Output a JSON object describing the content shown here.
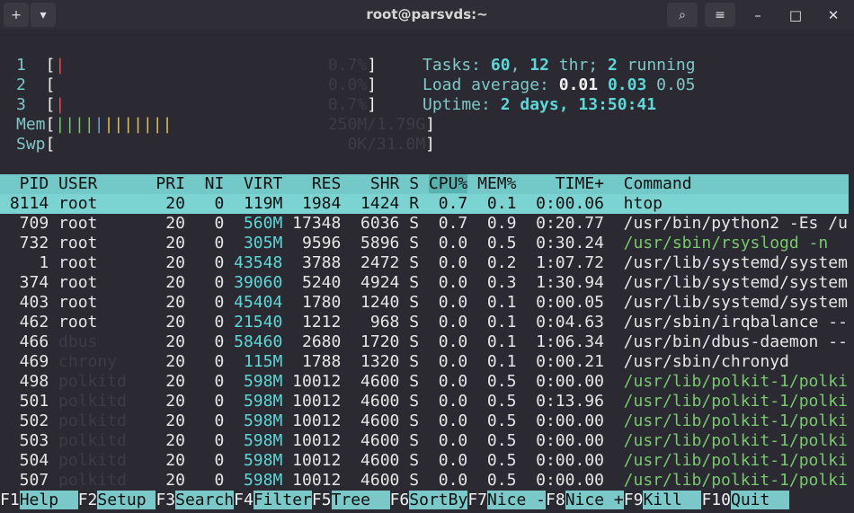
{
  "window": {
    "title": "root@parsvds:~",
    "buttons": {
      "new_tab": "+",
      "menu_dropdown": "▾",
      "search": "⌕",
      "hamburger": "≡",
      "minimize": "–",
      "maximize": "□",
      "close": "✕"
    }
  },
  "meters": {
    "cpu1": {
      "label": "1",
      "value": "0.7%"
    },
    "cpu2": {
      "label": "2",
      "value": "0.0%"
    },
    "cpu3": {
      "label": "3",
      "value": "0.7%"
    },
    "mem": {
      "label": "Mem",
      "value": "250M/1.79G"
    },
    "swp": {
      "label": "Swp",
      "value": "0K/31.0M"
    }
  },
  "summary": {
    "tasks_label": "Tasks:",
    "tasks": "60",
    "threads": "12",
    "thr_label": "thr;",
    "running": "2",
    "running_label": "running",
    "load_label": "Load average:",
    "load1": "0.01",
    "load5": "0.03",
    "load15": "0.05",
    "uptime_label": "Uptime:",
    "uptime": "2 days, 13:50:41"
  },
  "columns": [
    "PID",
    "USER",
    "PRI",
    "NI",
    "VIRT",
    "RES",
    "SHR",
    "S",
    "CPU%",
    "MEM%",
    "TIME+",
    "Command"
  ],
  "processes": [
    {
      "pid": "8114",
      "user": "root",
      "pri": "20",
      "ni": "0",
      "virt": "119M",
      "res": "1984",
      "shr": "1424",
      "s": "R",
      "cpu": "0.7",
      "mem": "0.1",
      "time": "0:00.06",
      "cmd": "htop"
    },
    {
      "pid": "709",
      "user": "root",
      "pri": "20",
      "ni": "0",
      "virt": "560M",
      "res": "17348",
      "shr": "6036",
      "s": "S",
      "cpu": "0.7",
      "mem": "0.9",
      "time": "0:20.77",
      "cmd": "/usr/bin/python2 -Es /u"
    },
    {
      "pid": "732",
      "user": "root",
      "pri": "20",
      "ni": "0",
      "virt": "305M",
      "res": "9596",
      "shr": "5896",
      "s": "S",
      "cpu": "0.0",
      "mem": "0.5",
      "time": "0:30.24",
      "cmd": "/usr/sbin/rsyslogd -n"
    },
    {
      "pid": "1",
      "user": "root",
      "pri": "20",
      "ni": "0",
      "virt": "43548",
      "res": "3788",
      "shr": "2472",
      "s": "S",
      "cpu": "0.0",
      "mem": "0.2",
      "time": "1:07.72",
      "cmd": "/usr/lib/systemd/system"
    },
    {
      "pid": "374",
      "user": "root",
      "pri": "20",
      "ni": "0",
      "virt": "39060",
      "res": "5240",
      "shr": "4924",
      "s": "S",
      "cpu": "0.0",
      "mem": "0.3",
      "time": "1:30.94",
      "cmd": "/usr/lib/systemd/system"
    },
    {
      "pid": "403",
      "user": "root",
      "pri": "20",
      "ni": "0",
      "virt": "45404",
      "res": "1780",
      "shr": "1240",
      "s": "S",
      "cpu": "0.0",
      "mem": "0.1",
      "time": "0:00.05",
      "cmd": "/usr/lib/systemd/system"
    },
    {
      "pid": "462",
      "user": "root",
      "pri": "20",
      "ni": "0",
      "virt": "21540",
      "res": "1212",
      "shr": "968",
      "s": "S",
      "cpu": "0.0",
      "mem": "0.1",
      "time": "0:04.63",
      "cmd": "/usr/sbin/irqbalance --"
    },
    {
      "pid": "466",
      "user": "dbus",
      "pri": "20",
      "ni": "0",
      "virt": "58460",
      "res": "2680",
      "shr": "1720",
      "s": "S",
      "cpu": "0.0",
      "mem": "0.1",
      "time": "1:06.34",
      "cmd": "/usr/bin/dbus-daemon --"
    },
    {
      "pid": "469",
      "user": "chrony",
      "pri": "20",
      "ni": "0",
      "virt": "115M",
      "res": "1788",
      "shr": "1320",
      "s": "S",
      "cpu": "0.0",
      "mem": "0.1",
      "time": "0:00.21",
      "cmd": "/usr/sbin/chronyd"
    },
    {
      "pid": "498",
      "user": "polkitd",
      "pri": "20",
      "ni": "0",
      "virt": "598M",
      "res": "10012",
      "shr": "4600",
      "s": "S",
      "cpu": "0.0",
      "mem": "0.5",
      "time": "0:00.00",
      "cmd": "/usr/lib/polkit-1/polki"
    },
    {
      "pid": "501",
      "user": "polkitd",
      "pri": "20",
      "ni": "0",
      "virt": "598M",
      "res": "10012",
      "shr": "4600",
      "s": "S",
      "cpu": "0.0",
      "mem": "0.5",
      "time": "0:13.96",
      "cmd": "/usr/lib/polkit-1/polki"
    },
    {
      "pid": "502",
      "user": "polkitd",
      "pri": "20",
      "ni": "0",
      "virt": "598M",
      "res": "10012",
      "shr": "4600",
      "s": "S",
      "cpu": "0.0",
      "mem": "0.5",
      "time": "0:00.00",
      "cmd": "/usr/lib/polkit-1/polki"
    },
    {
      "pid": "503",
      "user": "polkitd",
      "pri": "20",
      "ni": "0",
      "virt": "598M",
      "res": "10012",
      "shr": "4600",
      "s": "S",
      "cpu": "0.0",
      "mem": "0.5",
      "time": "0:00.00",
      "cmd": "/usr/lib/polkit-1/polki"
    },
    {
      "pid": "504",
      "user": "polkitd",
      "pri": "20",
      "ni": "0",
      "virt": "598M",
      "res": "10012",
      "shr": "4600",
      "s": "S",
      "cpu": "0.0",
      "mem": "0.5",
      "time": "0:00.00",
      "cmd": "/usr/lib/polkit-1/polki"
    },
    {
      "pid": "507",
      "user": "polkitd",
      "pri": "20",
      "ni": "0",
      "virt": "598M",
      "res": "10012",
      "shr": "4600",
      "s": "S",
      "cpu": "0.0",
      "mem": "0.5",
      "time": "0:00.00",
      "cmd": "/usr/lib/polkit-1/polki"
    }
  ],
  "function_keys": [
    {
      "key": "F1",
      "label": "Help  "
    },
    {
      "key": "F2",
      "label": "Setup "
    },
    {
      "key": "F3",
      "label": "Search"
    },
    {
      "key": "F4",
      "label": "Filter"
    },
    {
      "key": "F5",
      "label": "Tree  "
    },
    {
      "key": "F6",
      "label": "SortBy"
    },
    {
      "key": "F7",
      "label": "Nice -"
    },
    {
      "key": "F8",
      "label": "Nice +"
    },
    {
      "key": "F9",
      "label": "Kill  "
    },
    {
      "key": "F10",
      "label": "Quit  "
    }
  ]
}
